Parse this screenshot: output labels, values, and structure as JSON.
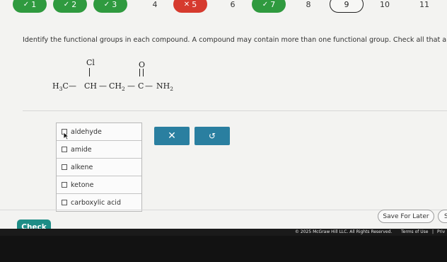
{
  "nav": {
    "items": [
      {
        "label": "1",
        "state": "correct"
      },
      {
        "label": "2",
        "state": "correct"
      },
      {
        "label": "3",
        "state": "correct"
      },
      {
        "label": "4",
        "state": "plain"
      },
      {
        "label": "5",
        "state": "incorrect"
      },
      {
        "label": "6",
        "state": "plain"
      },
      {
        "label": "7",
        "state": "correct"
      },
      {
        "label": "8",
        "state": "plain"
      },
      {
        "label": "9",
        "state": "current"
      },
      {
        "label": "10",
        "state": "plain"
      },
      {
        "label": "11",
        "state": "plain"
      }
    ],
    "check_mark": "✓",
    "x_mark": "✕"
  },
  "question": {
    "prompt": "Identify the functional groups in each compound. A compound may contain more than one functional group. Check all that apply."
  },
  "molecule": {
    "h3c": "H",
    "h3c_sub": "3",
    "h3c_c": "C",
    "ch": "CH",
    "ch2": "CH",
    "ch2_sub": "2",
    "c": "C",
    "nh2": "NH",
    "nh2_sub": "2",
    "cl": "Cl",
    "o": "O",
    "dash": "—"
  },
  "choices": [
    {
      "label": "aldehyde",
      "checked": false
    },
    {
      "label": "amide",
      "checked": false
    },
    {
      "label": "alkene",
      "checked": false
    },
    {
      "label": "ketone",
      "checked": false
    },
    {
      "label": "carboxylic acid",
      "checked": false
    }
  ],
  "actions": {
    "clear_label": "✕",
    "undo_label": "↺",
    "check_label": "Check",
    "save_label": "Save For Later",
    "submit_partial": "S"
  },
  "footer": {
    "copyright": "© 2025 McGraw Hill LLC. All Rights Reserved.",
    "terms": "Terms of Use",
    "sep": "|",
    "privacy": "Priv"
  },
  "colors": {
    "correct": "#2f9a3f",
    "incorrect": "#d63a2e",
    "action": "#2a7fa0",
    "check": "#1e8d86"
  }
}
